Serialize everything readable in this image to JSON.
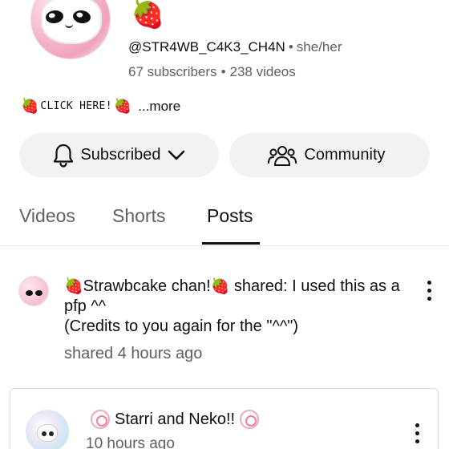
{
  "channel": {
    "header_emoji": "🍓",
    "handle": "@STR4WB_C4K3_CH4N",
    "pronoun_separator": "•",
    "pronouns": "she/her",
    "subscribers": "67 subscribers",
    "stats_separator": "•",
    "videos": "238 videos",
    "description": {
      "emoji_left": "🍓",
      "link_text": "CLICK HERE!",
      "emoji_right": "🍓",
      "more": "...more"
    }
  },
  "actions": {
    "subscribed_label": "Subscribed",
    "community_label": "Community"
  },
  "tabs": [
    {
      "label": "Videos",
      "active": false
    },
    {
      "label": "Shorts",
      "active": false
    },
    {
      "label": "Posts",
      "active": true
    }
  ],
  "shared_post": {
    "emoji_left": "🍓",
    "author": "Strawbcake chan!",
    "emoji_right": "🍓",
    "shared_label": "shared:",
    "text_line1": "I used this as a pfp ^^",
    "text_line2": "(Credits to you again for the \"^^\")",
    "time": "shared 4 hours ago"
  },
  "original_post": {
    "author": "Starri and Neko!!",
    "time": "10 hours ago"
  },
  "colors": {
    "text_primary": "#0f0f0f",
    "text_secondary": "#606060",
    "button_bg": "#f2f2f2",
    "strawberry": "#e02234"
  }
}
